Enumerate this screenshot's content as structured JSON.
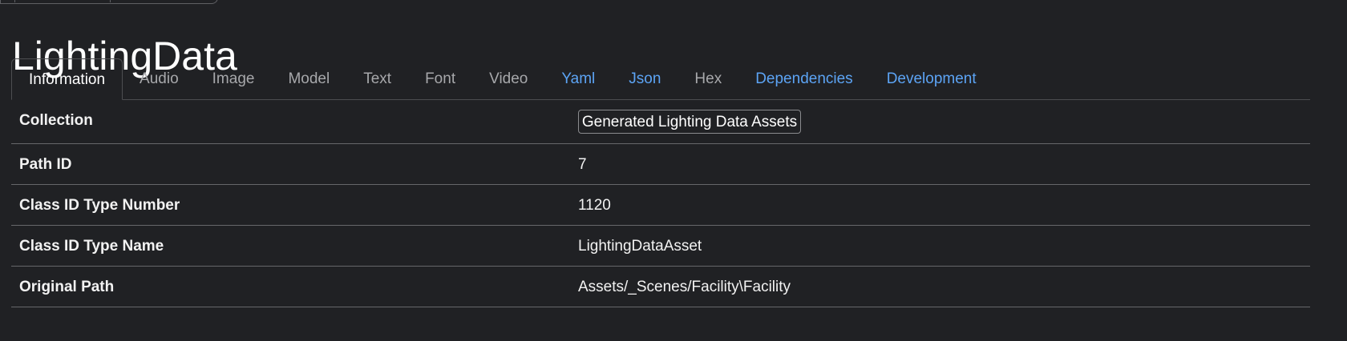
{
  "page": {
    "title": "LightingData"
  },
  "tabs": [
    {
      "label": "Information",
      "active": true,
      "link": false
    },
    {
      "label": "Audio",
      "active": false,
      "link": false
    },
    {
      "label": "Image",
      "active": false,
      "link": false
    },
    {
      "label": "Model",
      "active": false,
      "link": false
    },
    {
      "label": "Text",
      "active": false,
      "link": false
    },
    {
      "label": "Font",
      "active": false,
      "link": false
    },
    {
      "label": "Video",
      "active": false,
      "link": false
    },
    {
      "label": "Yaml",
      "active": false,
      "link": true
    },
    {
      "label": "Json",
      "active": false,
      "link": true
    },
    {
      "label": "Hex",
      "active": false,
      "link": false
    },
    {
      "label": "Dependencies",
      "active": false,
      "link": true
    },
    {
      "label": "Development",
      "active": false,
      "link": true
    }
  ],
  "info": {
    "collection_label": "Collection",
    "collection_value": "Generated Lighting Data Assets",
    "path_id_label": "Path ID",
    "path_id_value": "7",
    "class_id_number_label": "Class ID Type Number",
    "class_id_number_value": "1120",
    "class_id_name_label": "Class ID Type Name",
    "class_id_name_value": "LightingDataAsset",
    "original_path_label": "Original Path",
    "original_path_value": "Assets/_Scenes/Facility\\Facility"
  },
  "colors": {
    "background": "#202124",
    "link": "#5ca4f5",
    "inactive_tab": "#a7a8ab",
    "divider": "#66676a"
  }
}
